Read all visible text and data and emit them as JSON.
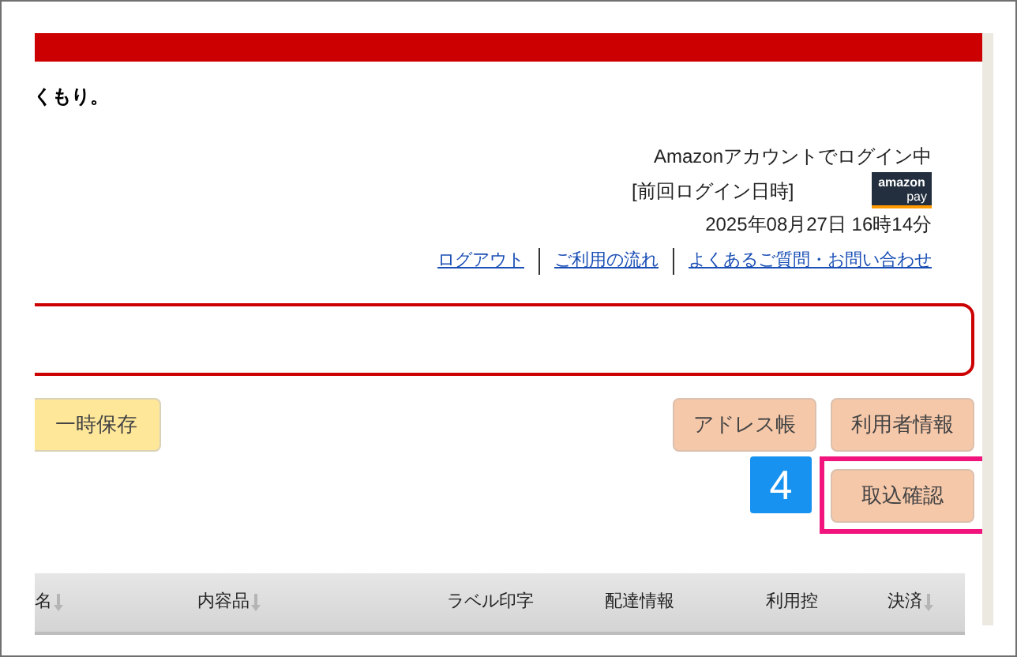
{
  "notice": "くもり。",
  "login": {
    "status": "Amazonアカウントでログイン中",
    "last_login_label": "[前回ログイン日時]",
    "last_login_time": "2025年08月27日 16時14分",
    "logo": {
      "line1": "amazon",
      "line2": "pay"
    }
  },
  "links": [
    "ログアウト",
    "ご利用の流れ",
    "よくあるご質問・お問い合わせ"
  ],
  "save_button": "一時保存",
  "right_buttons": [
    "アドレス帳",
    "利用者情報"
  ],
  "step_badge": "4",
  "import_button": {
    "label": "取込確認",
    "highlighted": true
  },
  "table": {
    "columns": [
      {
        "label": "名",
        "sortable": true
      },
      {
        "label": "内容品",
        "sortable": true
      },
      {
        "label": "ラベル印字",
        "sortable": false
      },
      {
        "label": "配達情報",
        "sortable": false
      },
      {
        "label": "利用控",
        "sortable": false
      },
      {
        "label": "決済",
        "sortable": true
      }
    ]
  }
}
